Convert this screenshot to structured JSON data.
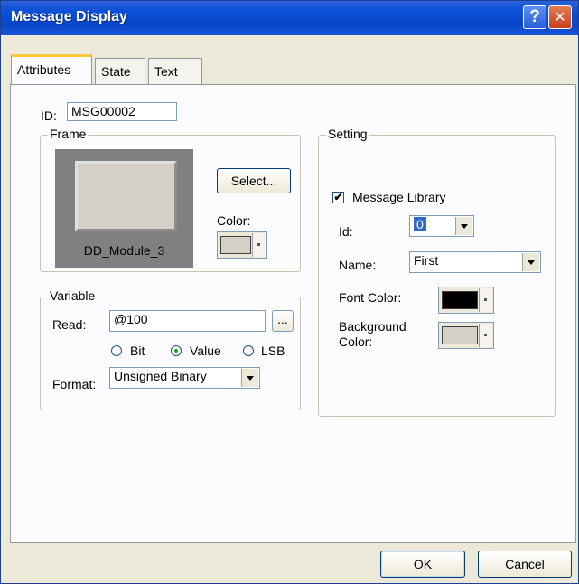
{
  "window": {
    "title": "Message Display",
    "help_icon": "?",
    "close_icon": "✕"
  },
  "tabs": [
    {
      "label": "Attributes",
      "active": true
    },
    {
      "label": "State",
      "active": false
    },
    {
      "label": "Text",
      "active": false
    }
  ],
  "id_field": {
    "label": "ID:",
    "value": "MSG00002"
  },
  "frame": {
    "title": "Frame",
    "preview_label": "DD_Module_3",
    "select_label": "Select...",
    "color_label": "Color:",
    "color": "#d4d0c8"
  },
  "variable": {
    "title": "Variable",
    "read_label": "Read:",
    "read_value": "@100",
    "browse_label": "...",
    "radios": [
      {
        "label": "Bit",
        "checked": false
      },
      {
        "label": "Value",
        "checked": true
      },
      {
        "label": "LSB",
        "checked": false
      }
    ],
    "format_label": "Format:",
    "format_value": "Unsigned Binary"
  },
  "setting": {
    "title": "Setting",
    "message_library_label": "Message Library",
    "message_library_checked": true,
    "check_mark": "✔",
    "id_label": "Id:",
    "id_value": "0",
    "name_label": "Name:",
    "name_value": "First",
    "font_color_label": "Font Color:",
    "font_color": "#000000",
    "bg_color_label_line1": "Background",
    "bg_color_label_line2": "Color:",
    "bg_color": "#d4d0c8"
  },
  "buttons": {
    "ok": "OK",
    "cancel": "Cancel"
  }
}
